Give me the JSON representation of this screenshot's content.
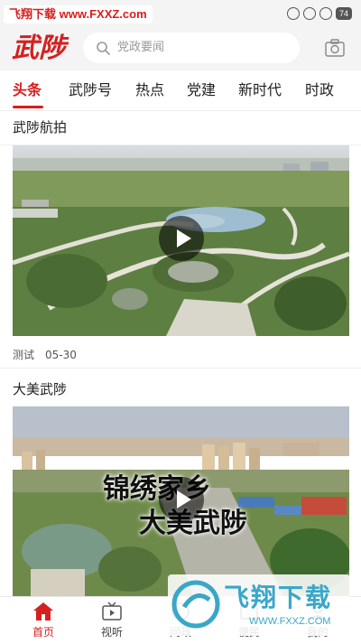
{
  "status_bar": {
    "watermark": "飞翔下载 www.FXXZ.com",
    "battery": "74"
  },
  "header": {
    "logo": "武陟",
    "search_placeholder": "党政要闻"
  },
  "tabs": [
    {
      "label": "头条",
      "active": true
    },
    {
      "label": "武陟号",
      "active": false
    },
    {
      "label": "热点",
      "active": false
    },
    {
      "label": "党建",
      "active": false
    },
    {
      "label": "新时代",
      "active": false
    },
    {
      "label": "时政",
      "active": false
    }
  ],
  "feed": [
    {
      "title": "武陟航拍",
      "meta_source": "测试",
      "meta_date": "05-30"
    },
    {
      "title": "大美武陟",
      "overlay_line1": "锦绣家乡",
      "overlay_line2": "大美武陟"
    }
  ],
  "bottom_nav": [
    {
      "label": "首页",
      "icon": "home-icon",
      "active": true
    },
    {
      "label": "视听",
      "icon": "tv-icon",
      "active": false
    },
    {
      "label": "问政",
      "icon": "question-icon",
      "active": false
    },
    {
      "label": "便民",
      "icon": "service-icon",
      "active": false
    },
    {
      "label": "我的",
      "icon": "user-icon",
      "active": false
    }
  ],
  "watermark_bottom": {
    "name": "飞翔下载",
    "url": "WWW.FXXZ.COM"
  },
  "colors": {
    "accent": "#d61f1f",
    "watermark": "#3aa7c9"
  }
}
